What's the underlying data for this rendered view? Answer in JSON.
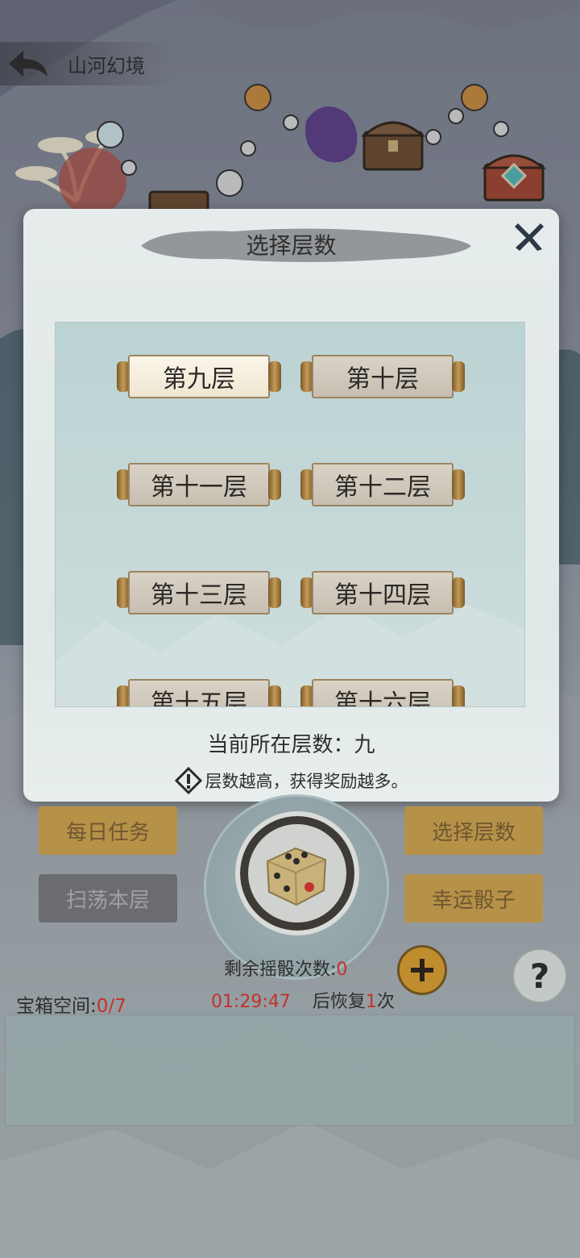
{
  "header": {
    "back_icon": "back-arrow-icon",
    "title": "山河幻境"
  },
  "modal": {
    "title": "选择层数",
    "close_icon": "close-x-icon",
    "floors": [
      {
        "label": "第九层",
        "selected": true
      },
      {
        "label": "第十层",
        "selected": false
      },
      {
        "label": "第十一层",
        "selected": false
      },
      {
        "label": "第十二层",
        "selected": false
      },
      {
        "label": "第十三层",
        "selected": false
      },
      {
        "label": "第十四层",
        "selected": false
      },
      {
        "label": "第十五层",
        "selected": false
      },
      {
        "label": "第十六层",
        "selected": false
      }
    ],
    "current_floor_text": "当前所在层数：九",
    "hint_icon": "warning-diamond-icon",
    "hint_text": "层数越高，获得奖励越多。"
  },
  "actions": {
    "daily_tasks": "每日任务",
    "sweep_floor": "扫荡本层",
    "select_floor": "选择层数",
    "lucky_dice": "幸运骰子"
  },
  "dice_area": {
    "remaining_label": "剩余摇骰次数:",
    "remaining_value": "0",
    "timer": "01:29:47",
    "recover_prefix": "后恢复",
    "recover_count": "1",
    "recover_suffix": "次",
    "plus_icon": "plus-icon",
    "help_icon": "question-mark-icon"
  },
  "chest_space": {
    "label": "宝箱空间:",
    "value": "0/7"
  },
  "colors": {
    "accent_gold": "#b69148",
    "value_red": "#c2322e"
  }
}
